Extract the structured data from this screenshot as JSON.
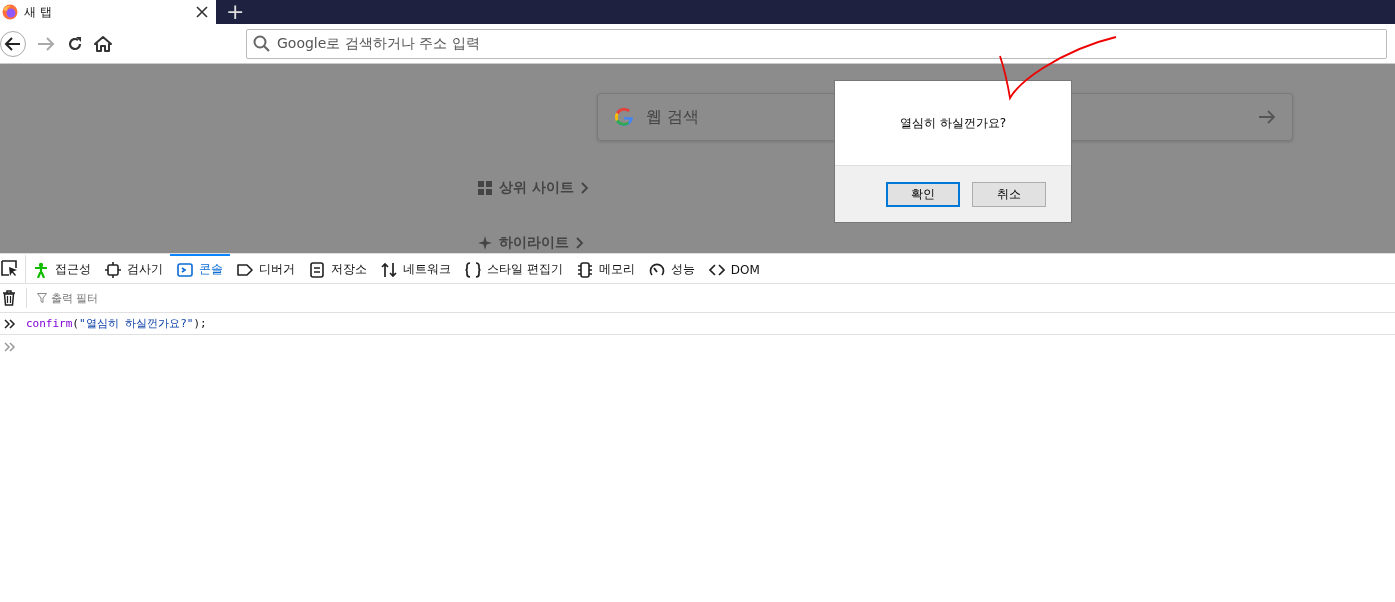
{
  "browser_tabs": [
    {
      "title": "새 탭",
      "selected": true
    }
  ],
  "new_tab_button": "+",
  "address_bar": {
    "placeholder": "Google로 검색하거나 주소 입력"
  },
  "nav": {
    "forward_disabled": true
  },
  "page": {
    "search": {
      "placeholder": "웹 검색"
    },
    "sections": [
      "상위 사이트",
      "하이라이트"
    ]
  },
  "dialog": {
    "message": "열심히 하실껀가요?",
    "buttons": [
      {
        "label": "확인",
        "focused": true
      },
      {
        "label": "취소",
        "focused": false
      }
    ]
  },
  "devtools": {
    "tabs": [
      {
        "label": "접근성",
        "selected": false
      },
      {
        "label": "검사기",
        "selected": false
      },
      {
        "label": "콘솔",
        "selected": true
      },
      {
        "label": "디버거",
        "selected": false
      },
      {
        "label": "저장소",
        "selected": false
      },
      {
        "label": "네트워크",
        "selected": false
      },
      {
        "label": "스타일 편집기",
        "selected": false
      },
      {
        "label": "메모리",
        "selected": false
      },
      {
        "label": "성능",
        "selected": false
      },
      {
        "label": "DOM",
        "selected": false
      }
    ],
    "filter": {
      "placeholder": "출력 필터"
    },
    "console_lines": [
      {
        "fn": "confirm",
        "open": "(",
        "arg": "\"열심히 하실껀가요?\"",
        "tail": ");"
      }
    ]
  }
}
